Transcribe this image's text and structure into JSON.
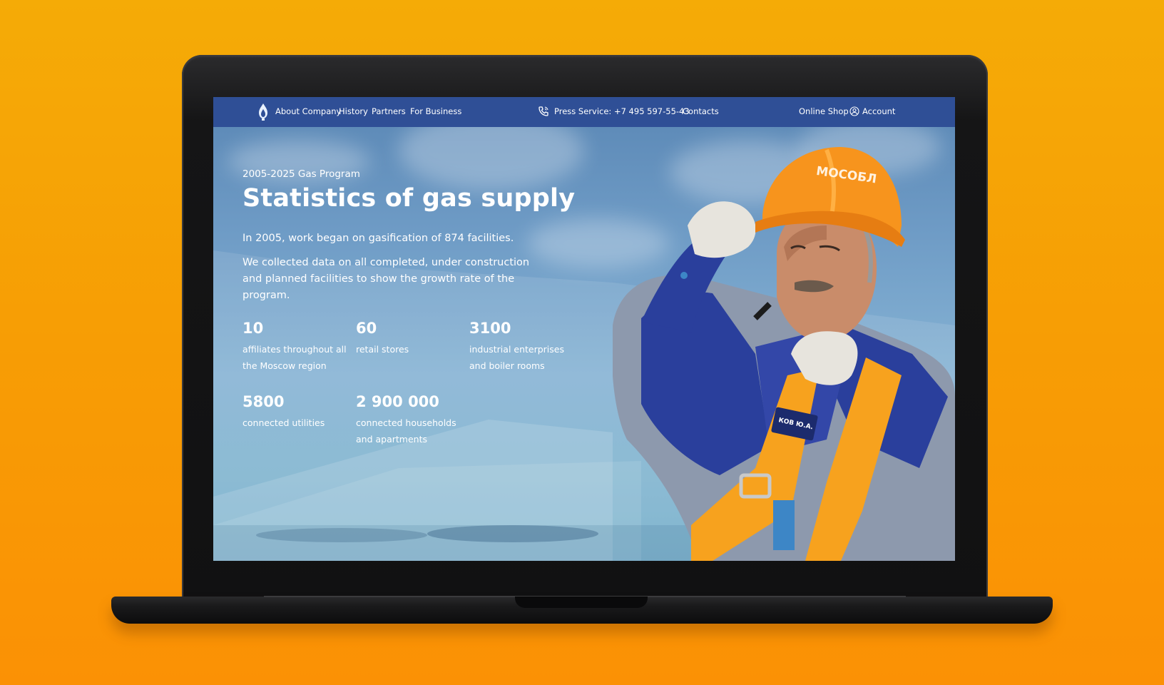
{
  "nav": {
    "items": [
      "About Company",
      "History",
      "Partners",
      "For Business"
    ],
    "press_service": "Press Service: +7 495 597-55-43",
    "contacts": "Contacts",
    "online_shop": "Online Shop",
    "account": "Account"
  },
  "hero": {
    "eyebrow": "2005-2025 Gas Program",
    "title": "Statistics of gas supply",
    "paragraph1": "In 2005, work began on gasification of 874 facilities.",
    "paragraph2": "We collected data on all completed, under construction and planned facilities to show the growth rate of the program."
  },
  "stats": [
    {
      "value": "10",
      "label": "affiliates throughout all the Moscow region"
    },
    {
      "value": "60",
      "label": "retail stores"
    },
    {
      "value": "3100",
      "label": "industrial enterprises and boiler rooms"
    },
    {
      "value": "5800",
      "label": "connected utilities"
    },
    {
      "value": "2 900 000",
      "label": "connected households and apartments"
    }
  ],
  "helmet_text": "МОСОБЛ",
  "badge_text": "КОВ Ю.А.",
  "colors": {
    "background": "#f7a005",
    "navbar": "#2f4f96",
    "helmet": "#f7941d",
    "uniform": "#2a3f9c"
  },
  "icons": [
    "flame-logo-icon",
    "phone-icon",
    "user-icon"
  ]
}
